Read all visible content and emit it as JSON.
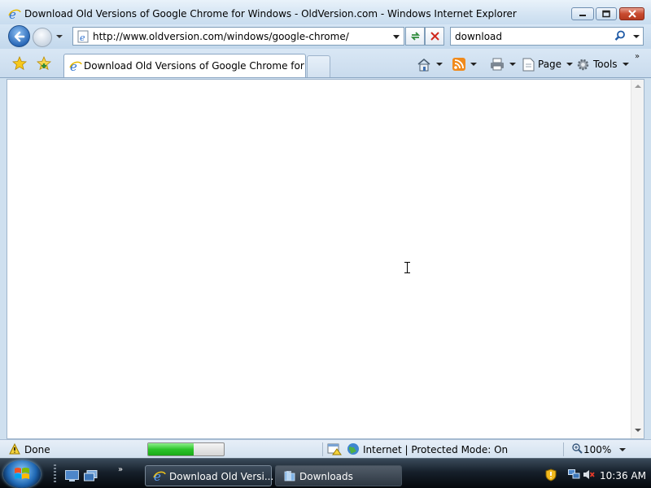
{
  "window": {
    "title": "Download Old Versions of Google Chrome for Windows - OldVersion.com - Windows Internet Explorer"
  },
  "navigation": {
    "address_url": "http://www.oldversion.com/windows/google-chrome/",
    "search_query": "download"
  },
  "tabs": [
    {
      "title": "Download Old Versions of Google Chrome for Wi...",
      "active": true
    }
  ],
  "command_bar": {
    "page_label": "Page",
    "tools_label": "Tools"
  },
  "status_bar": {
    "status_text": "Done",
    "progress_fraction": 0.6,
    "zone_text": "Internet | Protected Mode: On",
    "zoom": "100%"
  },
  "taskbar": {
    "buttons": [
      {
        "label": "Download Old Versi...",
        "active": true
      },
      {
        "label": "Downloads",
        "active": false
      }
    ],
    "clock": "10:36 AM"
  },
  "colors": {
    "ie_blue": "#2a69b8",
    "progress_green": "#2cc42a",
    "close_red": "#c84b2f"
  },
  "icons": {
    "app": "ie-icon",
    "back": "back-arrow-icon",
    "forward": "forward-arrow-icon",
    "refresh": "refresh-icon",
    "stop": "stop-icon",
    "search": "search-icon",
    "favorites": "favorites-star-icon",
    "add_favorites": "add-favorites-icon",
    "home": "home-icon",
    "feeds": "rss-feeds-icon",
    "print": "printer-icon",
    "page": "page-icon",
    "tools": "gear-icon",
    "warning": "warning-icon",
    "zone": "globe-icon",
    "zoom": "magnifier-icon",
    "start": "windows-logo-icon"
  }
}
